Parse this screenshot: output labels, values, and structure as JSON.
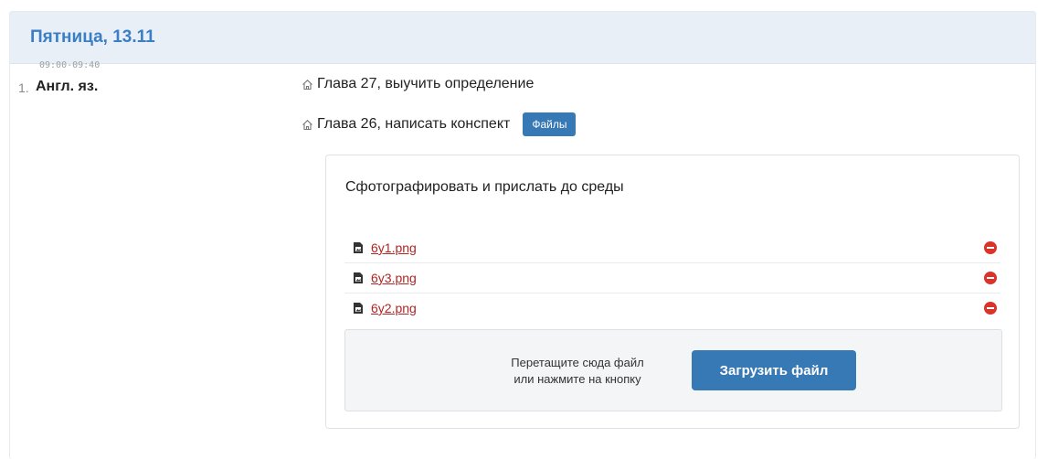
{
  "day": {
    "title": "Пятница, 13.11"
  },
  "lesson": {
    "time": "09:00-09:40",
    "number": "1.",
    "name": "Англ. яз.",
    "homework": [
      {
        "text": "Глава 27, выучить определение",
        "icon": "home-icon"
      },
      {
        "text": "Глава 26, написать конспект",
        "icon": "home-icon",
        "button": "Файлы"
      }
    ]
  },
  "files": {
    "description": "Сфотографировать и прислать до среды",
    "items": [
      {
        "name": "6y1.png",
        "icon": "file-image-icon",
        "action_icon": "delete-icon"
      },
      {
        "name": "6y3.png",
        "icon": "file-image-icon",
        "action_icon": "delete-icon"
      },
      {
        "name": "6y2.png",
        "icon": "file-image-icon",
        "action_icon": "delete-icon"
      }
    ],
    "dropzone": {
      "hint_line1": "Перетащите сюда файл",
      "hint_line2": "или нажмите на кнопку",
      "upload_label": "Загрузить файл"
    }
  },
  "colors": {
    "accent": "#3779b4",
    "title": "#3a7ec5",
    "link": "#b32424",
    "delete": "#d9332a",
    "header_bg": "#e9eff6"
  }
}
